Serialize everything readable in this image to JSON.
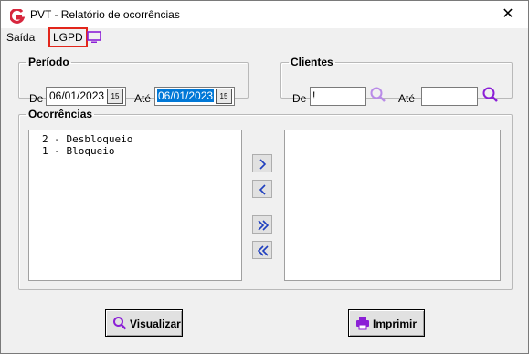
{
  "window": {
    "title": "PVT - Relatório de ocorrências",
    "close_glyph": "✕",
    "app_icon": "g-logo-icon"
  },
  "menu": {
    "items": [
      {
        "label": "Saída"
      },
      {
        "label": "LGPD"
      }
    ],
    "monitor_icon": "monitor-icon"
  },
  "periodo": {
    "legend": "Período",
    "from_label": "De",
    "from_value": "06/01/2023",
    "to_label": "Até",
    "to_value": "06/01/2023",
    "calendar_glyph": "15"
  },
  "clientes": {
    "legend": "Clientes",
    "from_label": "De",
    "from_value": "!",
    "to_label": "Até",
    "to_value": ""
  },
  "ocorrencias": {
    "legend": "Ocorrências",
    "available": [
      "2 - Desbloqueio",
      "1 - Bloqueio"
    ],
    "selected": []
  },
  "buttons": {
    "visualizar": "Visualizar",
    "imprimir": "Imprimir"
  },
  "colors": {
    "accent_purple": "#8b1fd6",
    "highlight_blue": "#0078d7",
    "lgpd_border": "#e2261b",
    "arrow_blue": "#1f3fbf"
  }
}
